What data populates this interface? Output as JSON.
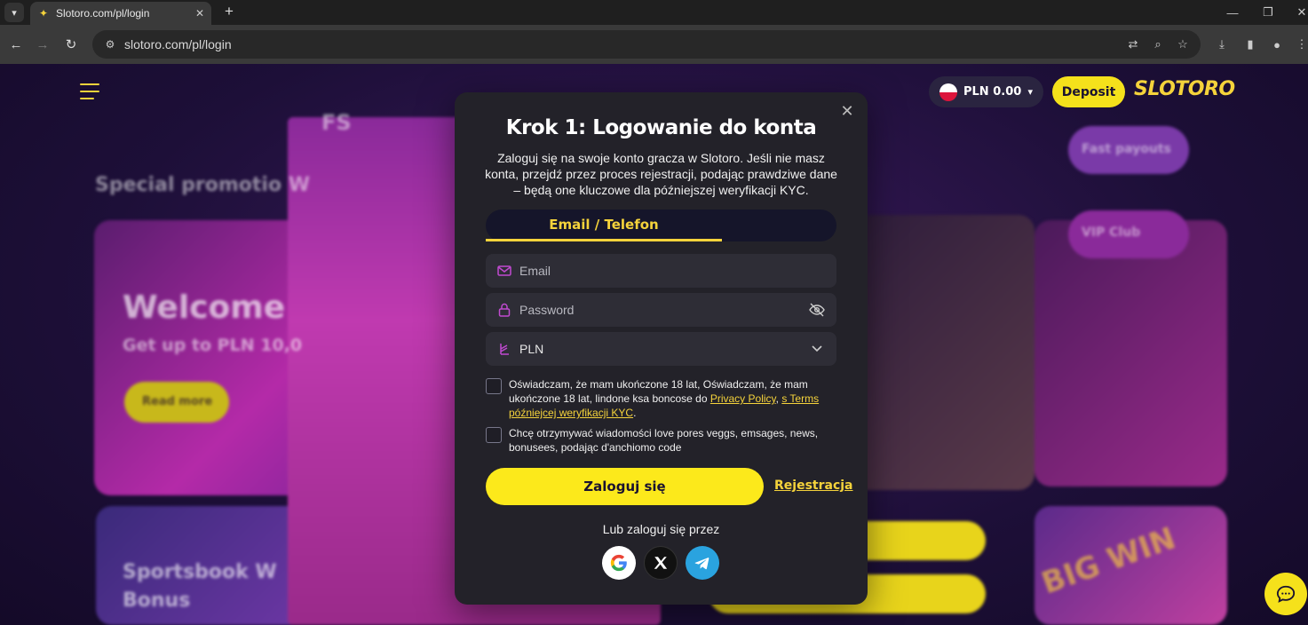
{
  "browser": {
    "tab_title": "Slotoro.com/pl/login",
    "url": "slotoro.com/pl/login"
  },
  "header": {
    "currency_display": "PLN 0.00",
    "deposit_label": "Deposit",
    "logo_text": "SLOTORO"
  },
  "background": {
    "section_title": "Special promotio W",
    "welcome_title": "Welcome",
    "welcome_sub": "Get up to PLN 10,0",
    "read_more": "Read more",
    "sportsbook_line1": "Sportsbook W",
    "sportsbook_line2": "Bonus",
    "fast_payouts": "Fast payouts",
    "vip_club": "VIP Club",
    "fs_label": "FS",
    "big_win": "BIG WIN"
  },
  "modal": {
    "title": "Krok 1: Logowanie do konta",
    "description": "Zaloguj się na swoje konto gracza w Slotoro. Jeśli nie masz konta, przejdź przez proces rejestracji, podając prawdziwe dane – będą one kluczowe dla późniejszej weryfikacji KYC.",
    "tab_label": "Email / Telefon",
    "email_placeholder": "Email",
    "password_placeholder": "Password",
    "currency_value": "PLN",
    "checkbox1_text": "Oświadczam, że mam ukończone 18 lat, Oświadczam, że mam ukończone 18 lat, lindone ksa boncose do",
    "checkbox1_link1": "Privacy Policy",
    "checkbox1_sep": ", ",
    "checkbox1_link2": "s Terms późniejcej weryfikacji KYC",
    "checkbox1_end": ".",
    "checkbox2_text": "Chcę otrzymywać wiadomości love pores veggs, emsages, news, bonusees, podając d'anchiomo code",
    "login_button": "Zaloguj się",
    "register_link": "Rejestracja",
    "or_text": "Lub zaloguj się przez"
  }
}
